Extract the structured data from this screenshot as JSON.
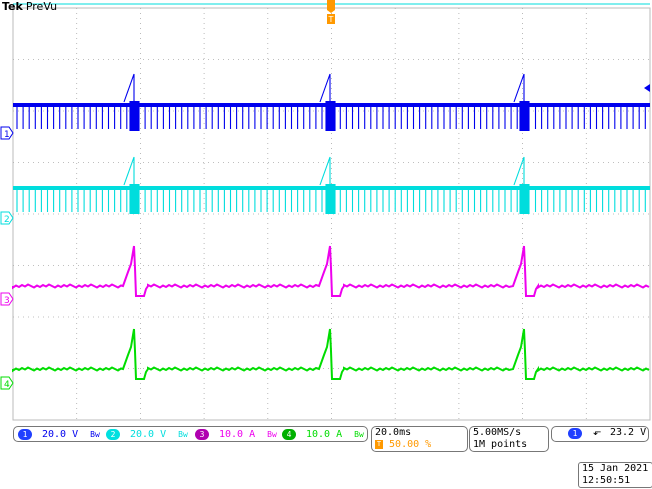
{
  "brand": {
    "name": "Tek",
    "mode": "PreVu"
  },
  "chart_data": {
    "type": "line",
    "title": "",
    "grid": true,
    "trigger_marker": "T",
    "series": [
      {
        "name": "1",
        "color": "#0000ee",
        "kind": "spiky"
      },
      {
        "name": "2",
        "color": "#00dddd",
        "kind": "spiky"
      },
      {
        "name": "3",
        "color": "#ee00ee",
        "kind": "ramp"
      },
      {
        "name": "4",
        "color": "#00dd00",
        "kind": "ramp"
      }
    ],
    "cycle_positions": [
      "132",
      "328",
      "522"
    ]
  },
  "channels": [
    {
      "id": "1",
      "scale": "20.0 V",
      "color": "#0000ee",
      "badge_color": "#2040ff"
    },
    {
      "id": "2",
      "scale": "20.0 V",
      "color": "#00dddd",
      "badge_color": "#00e0e0"
    },
    {
      "id": "3",
      "scale": "10.0 A",
      "color": "#ee00ee",
      "badge_color": "#b000b0"
    },
    {
      "id": "4",
      "scale": "10.0 A",
      "color": "#00dd00",
      "badge_color": "#00b000"
    }
  ],
  "bandwidth_symbol": "Bw",
  "timebase": {
    "per_div": "20.0ms",
    "trigger_position": "50.00 %",
    "trigger_position_color": "#ff9900"
  },
  "acquisition": {
    "rate": "5.00MS/s",
    "record": "1M points"
  },
  "trigger": {
    "source": "1",
    "slope": "falling",
    "level": "23.2 V"
  },
  "datetime": {
    "date": "15 Jan  2021",
    "time": "12:50:51"
  }
}
